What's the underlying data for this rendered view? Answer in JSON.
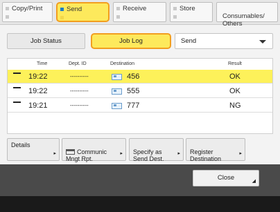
{
  "top_tabs": [
    {
      "label": "Copy/Print",
      "active": false
    },
    {
      "label": "Send",
      "active": true
    },
    {
      "label": "Receive",
      "active": false
    },
    {
      "label": "Store",
      "active": false
    },
    {
      "label": "Consumables/\nOthers",
      "active": false
    }
  ],
  "sub_tabs": {
    "job_status": "Job Status",
    "job_log": "Job Log"
  },
  "send_filter": {
    "value": "Send"
  },
  "table": {
    "headers": {
      "time": "Time",
      "dept": "Dept. ID",
      "destination": "Destination",
      "result": "Result"
    },
    "rows": [
      {
        "time": "19:22",
        "dept": "----------",
        "destination": "456",
        "result": "OK",
        "selected": true
      },
      {
        "time": "19:22",
        "dept": "----------",
        "destination": "555",
        "result": "OK",
        "selected": false
      },
      {
        "time": "19:21",
        "dept": "----------",
        "destination": "777",
        "result": "NG",
        "selected": false
      }
    ]
  },
  "actions": {
    "details": "Details",
    "communic": "Communic\nMngt Rpt.",
    "specify": "Specify as\nSend Dest.",
    "register": "Register\nDestination"
  },
  "close": "Close",
  "colors": {
    "highlight": "#fde95c",
    "highlight_border": "#f29e1f",
    "footer": "#4a4a4a"
  }
}
